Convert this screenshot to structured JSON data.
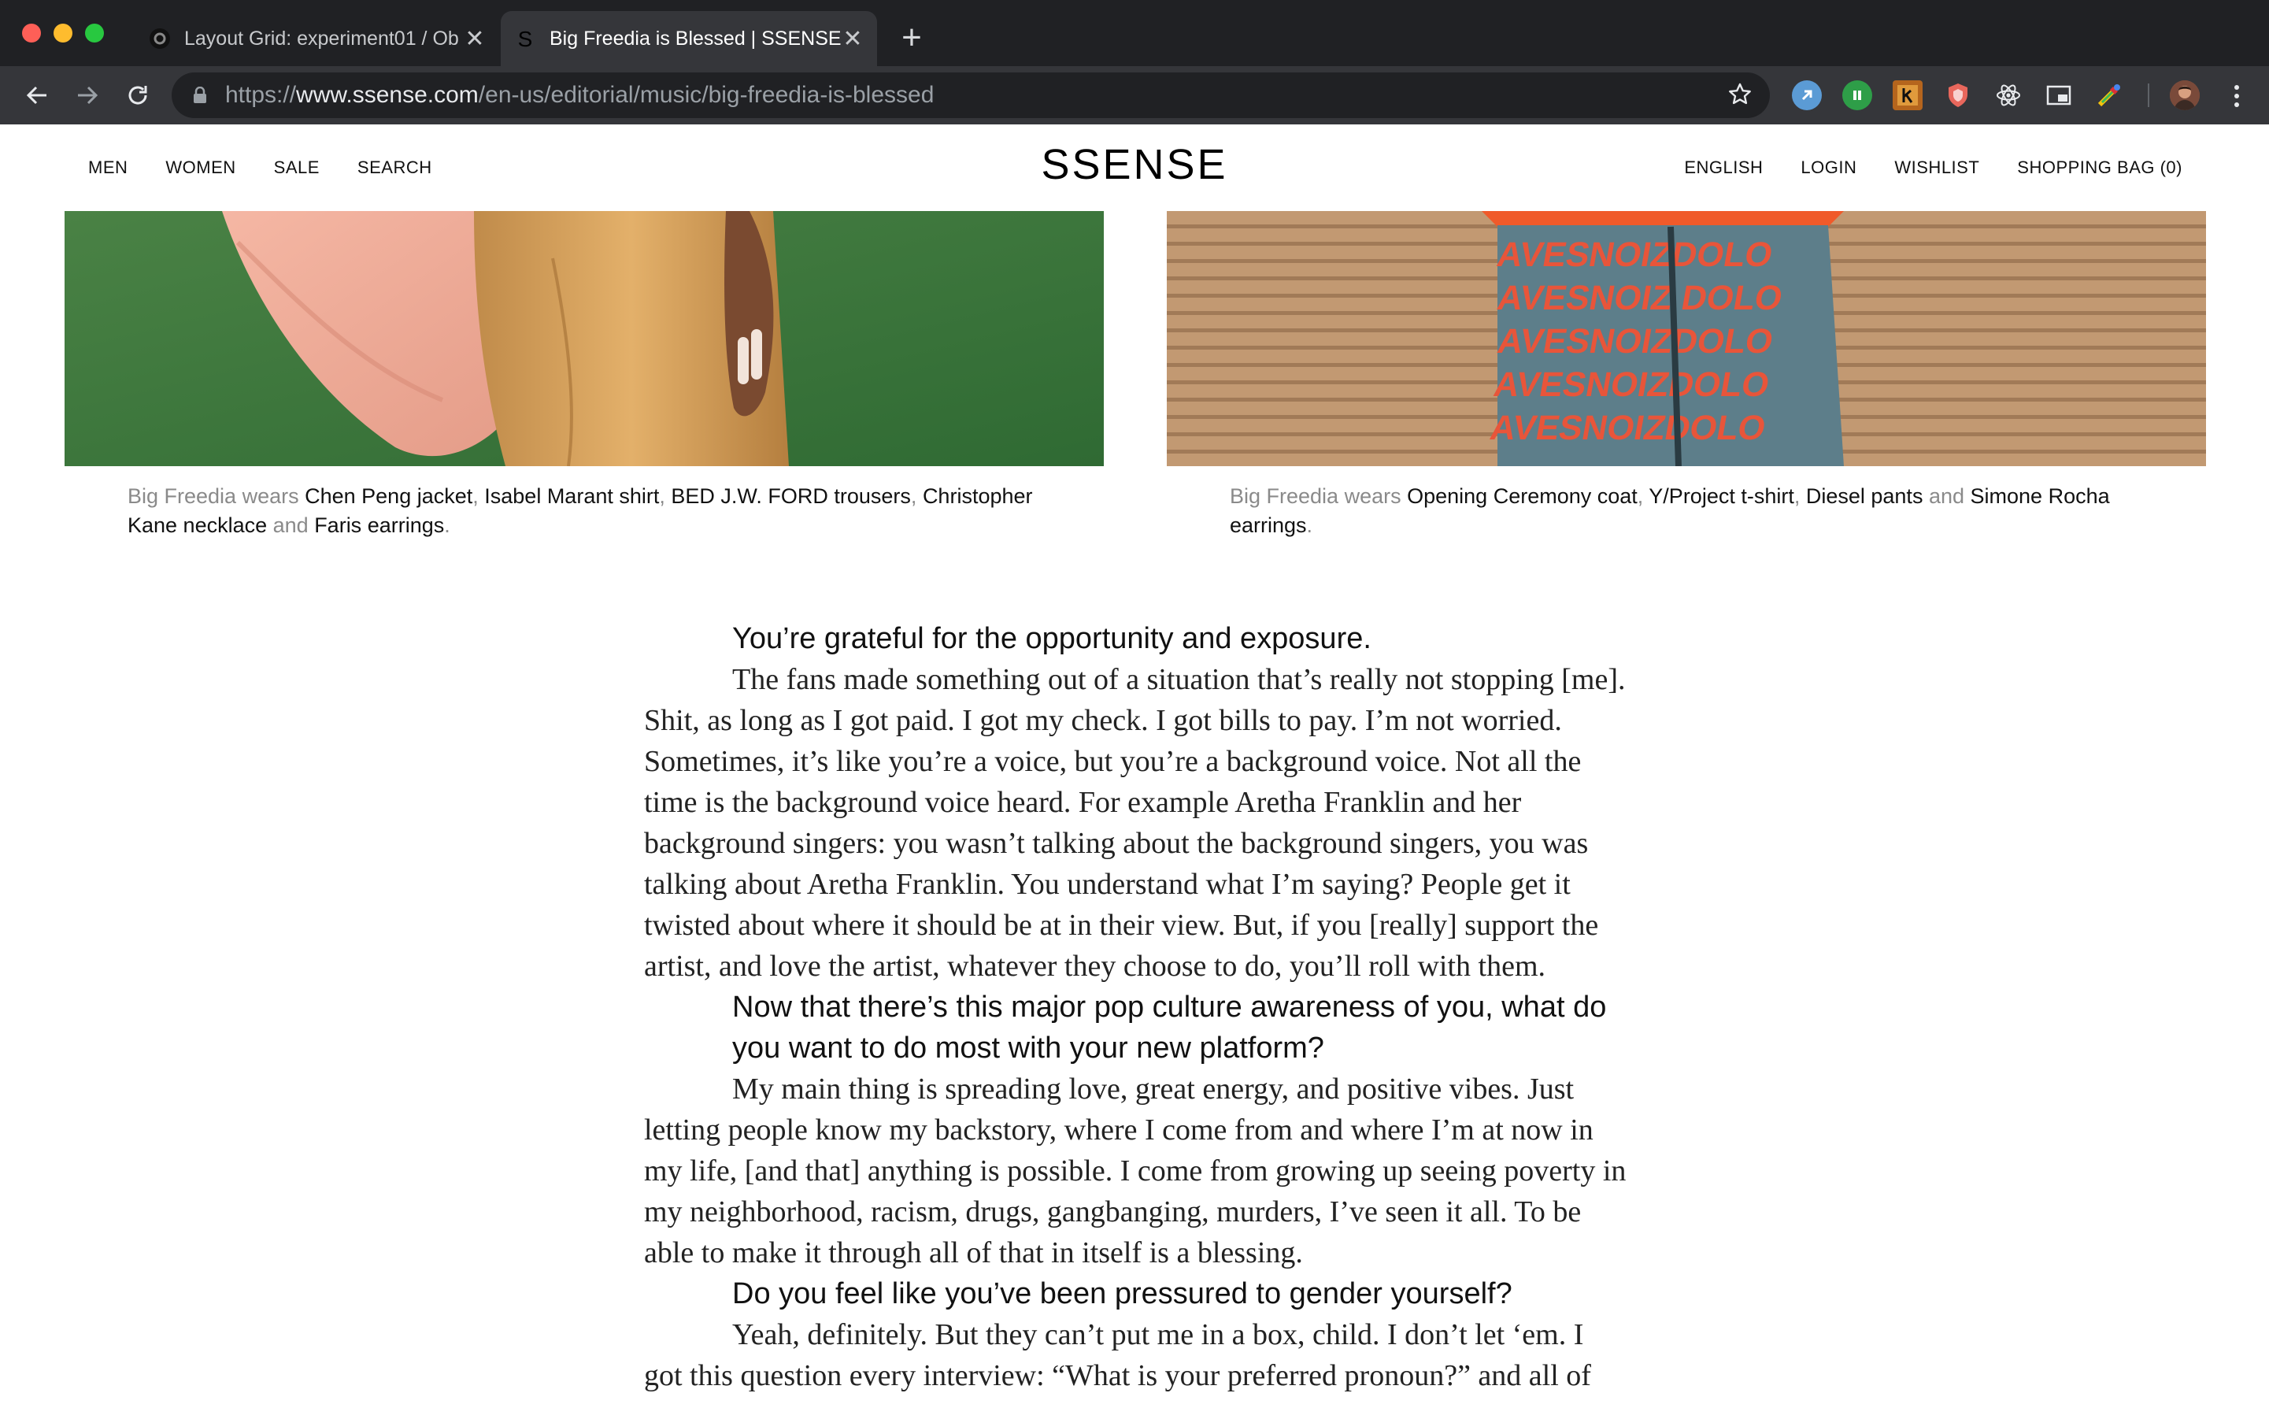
{
  "browser": {
    "tabs": [
      {
        "title": "Layout Grid: experiment01 / Ob",
        "active": false
      },
      {
        "title": "Big Freedia is Blessed | SSENSE",
        "active": true
      }
    ],
    "url_prefix": "https://",
    "url_domain": "www.ssense.com",
    "url_path": "/en-us/editorial/music/big-freedia-is-blessed",
    "tab_close_glyph": "✕",
    "new_tab_glyph": "+"
  },
  "header": {
    "logo": "SSENSE",
    "nav_left": [
      "MEN",
      "WOMEN",
      "SALE",
      "SEARCH"
    ],
    "nav_right": [
      "ENGLISH",
      "LOGIN",
      "WISHLIST",
      "SHOPPING BAG (0)"
    ]
  },
  "captions": {
    "left": [
      {
        "text": "Big Freedia wears ",
        "muted": true
      },
      {
        "text": "Chen Peng jacket",
        "muted": false
      },
      {
        "text": ", ",
        "muted": true
      },
      {
        "text": "Isabel Marant shirt",
        "muted": false
      },
      {
        "text": ", ",
        "muted": true
      },
      {
        "text": "BED J.W. FORD trousers",
        "muted": false
      },
      {
        "text": ", ",
        "muted": true
      },
      {
        "text": "Christopher Kane necklace",
        "muted": false
      },
      {
        "text": " and ",
        "muted": true
      },
      {
        "text": "Faris earrings",
        "muted": false
      },
      {
        "text": ".",
        "muted": true
      }
    ],
    "right": [
      {
        "text": "Big Freedia wears ",
        "muted": true
      },
      {
        "text": "Opening Ceremony coat",
        "muted": false
      },
      {
        "text": ", ",
        "muted": true
      },
      {
        "text": "Y/Project t-shirt",
        "muted": false
      },
      {
        "text": ", ",
        "muted": true
      },
      {
        "text": "Diesel pants",
        "muted": false
      },
      {
        "text": " and ",
        "muted": true
      },
      {
        "text": "Simone Rocha earrings",
        "muted": false
      },
      {
        "text": ".",
        "muted": true
      }
    ]
  },
  "article": {
    "q1": "You’re grateful for the opportunity and exposure.",
    "a1": "The fans made something out of a situation that’s really not stopping [me]. Shit, as long as I got paid. I got my check. I got bills to pay. I’m not worried. Sometimes, it’s like you’re a voice, but you’re a background voice. Not all the time is the background voice heard. For example Aretha Franklin and her background singers: you wasn’t talking about the background singers, you was talking about Aretha Franklin. You understand what I’m saying? People get it twisted about where it should be at in their view. But, if you [really] support the artist, and love the artist, whatever they choose to do, you’ll roll with them.",
    "q2": "Now that there’s this major pop culture awareness of you, what do you want to do most with your new platform?",
    "a2": "My main thing is spreading love, great energy, and positive vibes. Just letting people know my backstory, where I come from and where I’m at now in my life, [and that] anything is possible. I come from growing up seeing poverty in my neighborhood, racism, drugs, gangbanging, murders, I’ve seen it all. To be able to make it through all of that in itself is a blessing.",
    "q3": "Do you feel like you’ve been pressured to gender yourself?",
    "a3": "Yeah, definitely. But they can’t put me in a box, child. I don’t let ‘em. I got this question every interview: “What is your preferred pronoun?” and all of"
  },
  "colors": {
    "chrome_dark": "#202124",
    "chrome_toolbar": "#35363a",
    "caption_muted": "#8a8a8a",
    "photo_left_bg": "#3f7a3c",
    "photo_right_bg": "#c9a27a"
  },
  "icons": {
    "inactive_tab_favicon": "figma-like-circle-icon",
    "active_tab_favicon": "ssense-s-icon",
    "extensions": [
      "copy-extension-icon",
      "green-extension-icon",
      "k-extension-icon",
      "shield-extension-icon",
      "react-devtools-icon",
      "pip-icon",
      "color-picker-icon"
    ]
  }
}
